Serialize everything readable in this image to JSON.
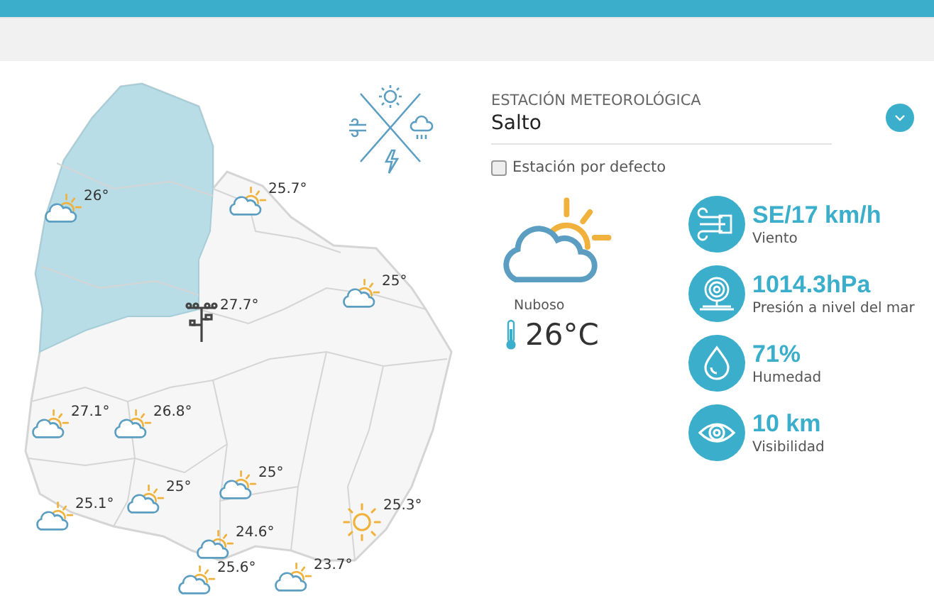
{
  "map": {
    "stations": [
      {
        "kind": "partly-cloudy",
        "temp": "26°"
      },
      {
        "kind": "partly-cloudy",
        "temp": "25.7°"
      },
      {
        "kind": "partly-cloudy",
        "temp": "25°"
      },
      {
        "kind": "station",
        "temp": "27.7°"
      },
      {
        "kind": "partly-cloudy",
        "temp": "27.1°"
      },
      {
        "kind": "partly-cloudy",
        "temp": "26.8°"
      },
      {
        "kind": "partly-cloudy",
        "temp": "25°"
      },
      {
        "kind": "partly-cloudy",
        "temp": "25°"
      },
      {
        "kind": "partly-cloudy",
        "temp": "25.1°"
      },
      {
        "kind": "sunny",
        "temp": "25.3°"
      },
      {
        "kind": "partly-cloudy",
        "temp": "24.6°"
      },
      {
        "kind": "partly-cloudy",
        "temp": "25.6°"
      },
      {
        "kind": "partly-cloudy",
        "temp": "23.7°"
      }
    ]
  },
  "station_select": {
    "label": "ESTACIÓN METEOROLÓGICA",
    "value": "Salto"
  },
  "default_station": {
    "label": "Estación por defecto",
    "checked": false
  },
  "current": {
    "kind": "partly-cloudy",
    "condition": "Nuboso",
    "temperature": "26°C"
  },
  "stats": [
    {
      "kind": "wind",
      "value": "SE/17 km/h",
      "label": "Viento"
    },
    {
      "kind": "pressure",
      "value": "1014.3hPa",
      "label": "Presión a nivel del mar"
    },
    {
      "kind": "humidity",
      "value": "71%",
      "label": "Humedad"
    },
    {
      "kind": "visibility",
      "value": "10 km",
      "label": "Visibilidad"
    }
  ]
}
